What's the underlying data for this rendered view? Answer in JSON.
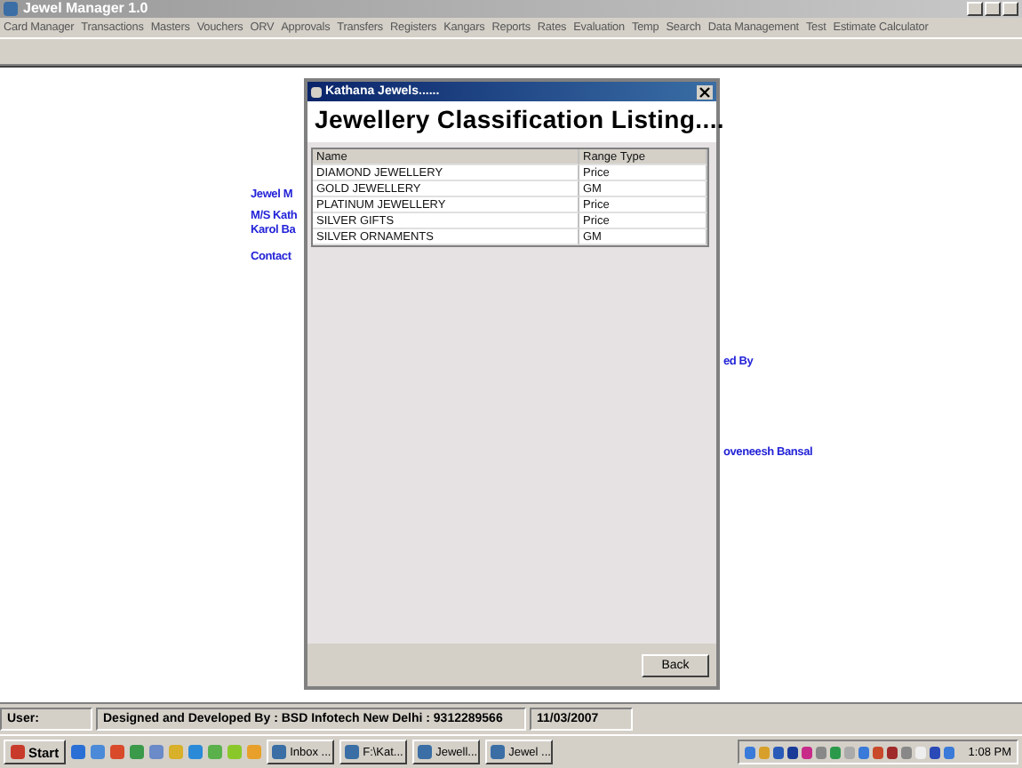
{
  "window": {
    "title": "Jewel Manager 1.0"
  },
  "menu": [
    "Card Manager",
    "Transactions",
    "Masters",
    "Vouchers",
    "ORV",
    "Approvals",
    "Transfers",
    "Registers",
    "Kangars",
    "Reports",
    "Rates",
    "Evaluation",
    "Temp",
    "Search",
    "Data Management",
    "Test",
    "Estimate Calculator"
  ],
  "background_texts": [
    "Jewel M",
    "M/S Kath",
    "Karol Ba",
    "Contact",
    "ed By",
    "oveneesh Bansal"
  ],
  "dialog": {
    "title": "Kathana Jewels......",
    "heading": "Jewellery Classification Listing....",
    "columns": [
      "Name",
      "Range Type"
    ],
    "rows": [
      [
        "DIAMOND JEWELLERY",
        "Price"
      ],
      [
        "GOLD JEWELLERY",
        "GM"
      ],
      [
        "PLATINUM JEWELLERY",
        "Price"
      ],
      [
        "SILVER GIFTS",
        "Price"
      ],
      [
        "SILVER ORNAMENTS",
        "GM"
      ]
    ],
    "button": "Back"
  },
  "status_bar": [
    "User:",
    "Designed and Developed By : BSD Infotech New Delhi : 9312289566",
    "11/03/2007"
  ],
  "taskbar": {
    "start": "Start",
    "tasks": [
      "Inbox ...",
      "F:\\Kat...",
      "Jewell...",
      "Jewel ..."
    ],
    "clock": "1:08 PM"
  }
}
